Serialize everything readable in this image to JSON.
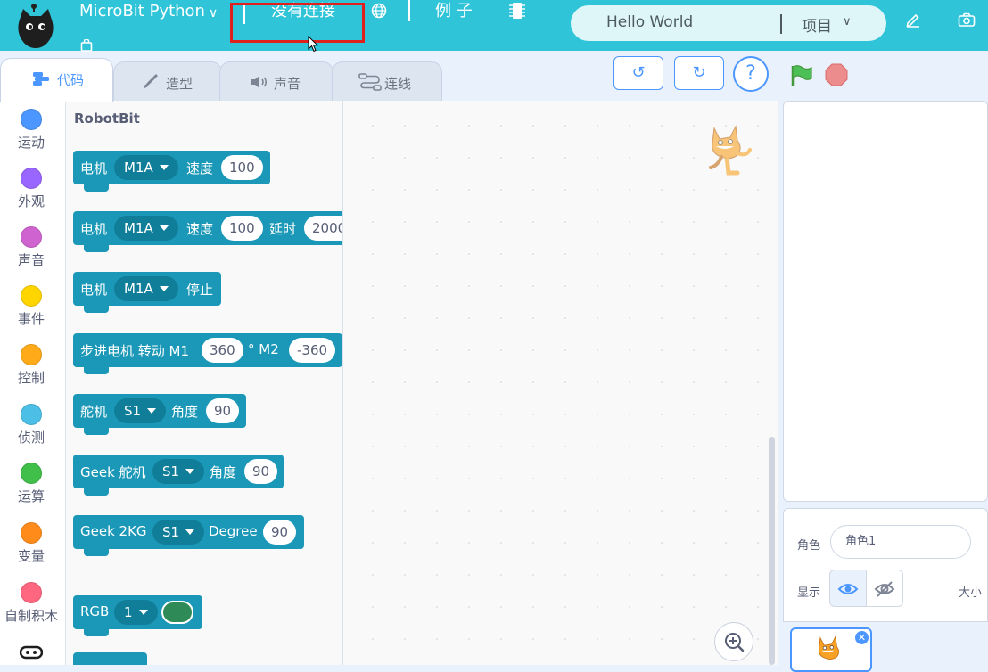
{
  "menubar": {
    "mode_label": "MicroBit Python",
    "mode_chevron": "∨",
    "connection_label": "没有连接",
    "examples_label": "例 子",
    "project_title": "Hello World",
    "project_menu_label": "项目",
    "project_chevron": "∨",
    "bg_color": "#2fc4d8"
  },
  "tabs": [
    {
      "label": "代码",
      "icon": "code-icon"
    },
    {
      "label": "造型",
      "icon": "brush-icon"
    },
    {
      "label": "声音",
      "icon": "speaker-icon"
    },
    {
      "label": "连线",
      "icon": "wiring-icon"
    }
  ],
  "toolbar": {
    "undo_symbol": "↺",
    "redo_symbol": "↻",
    "help_symbol": "?"
  },
  "categories": [
    {
      "label": "运动",
      "color": "#4c97ff"
    },
    {
      "label": "外观",
      "color": "#9966ff"
    },
    {
      "label": "声音",
      "color": "#cf63cf"
    },
    {
      "label": "事件",
      "color": "#ffd500"
    },
    {
      "label": "控制",
      "color": "#ffab19"
    },
    {
      "label": "侦测",
      "color": "#4cbfe6"
    },
    {
      "label": "运算",
      "color": "#40bf4a"
    },
    {
      "label": "变量",
      "color": "#ff8c1a"
    },
    {
      "label": "自制积木",
      "color": "#ff6680"
    }
  ],
  "palette": {
    "section_title": "RobotBit",
    "block_color": "#1b98b7",
    "blocks": [
      {
        "t1": "电机",
        "dd": "M1A",
        "t2": "速度",
        "n1": "100"
      },
      {
        "t1": "电机",
        "dd": "M1A",
        "t2": "速度",
        "n1": "100",
        "t3": "延时",
        "n2": "2000"
      },
      {
        "t1": "电机",
        "dd": "M1A",
        "t2": "停止"
      },
      {
        "t1": "步进电机 转动 M1",
        "n1": "360",
        "t2": "° M2",
        "n2": "-360"
      },
      {
        "t1": "舵机",
        "dd": "S1",
        "t2": "角度",
        "n1": "90"
      },
      {
        "t1": "Geek 舵机",
        "dd": "S1",
        "t2": "角度",
        "n1": "90"
      },
      {
        "t1": "Geek 2KG",
        "dd": "S1",
        "t2": "Degree",
        "n1": "90"
      },
      {
        "t1": "RGB",
        "dd": "1"
      }
    ]
  },
  "sprite_info": {
    "sprite_label": "角色",
    "sprite_name": "角色1",
    "show_label": "显示",
    "size_label": "大小"
  }
}
